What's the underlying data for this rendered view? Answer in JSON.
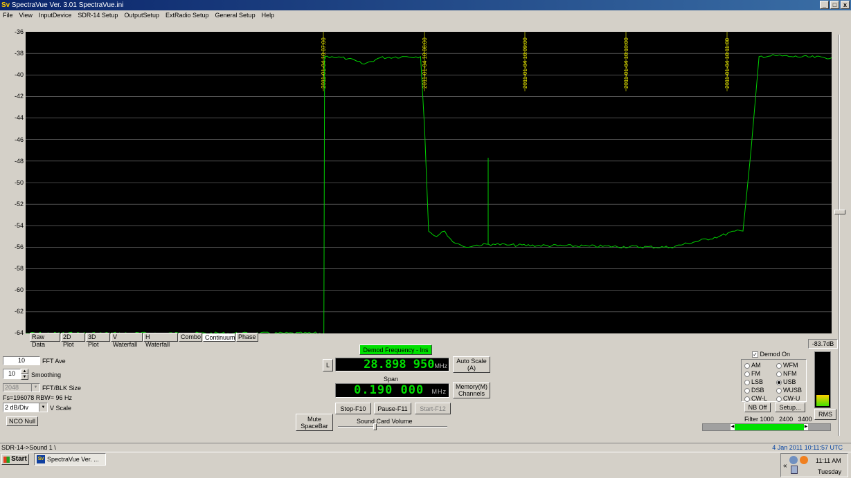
{
  "window": {
    "title": "SpectraVue Ver. 3.01 SpectraVue.ini",
    "logo": "Sv",
    "minimize": "_",
    "restore": "□",
    "close": "x"
  },
  "menu": [
    "File",
    "View",
    "InputDevice",
    "SDR-14 Setup",
    "OutputSetup",
    "ExtRadio Setup",
    "General Setup",
    "Help"
  ],
  "plot": {
    "y_ticks": [
      "-36",
      "-38",
      "-40",
      "-42",
      "-44",
      "-46",
      "-48",
      "-50",
      "-52",
      "-54",
      "-56",
      "-58",
      "-60",
      "-62",
      "-64"
    ],
    "time_marks": [
      "2011-01-04 10:07:00",
      "2011-01-04 10:08:00",
      "2011-01-04 10:09:00",
      "2011-01-04 10:10:00",
      "2011-01-04 10:11:00"
    ],
    "trace_color": "#00d000",
    "grid_color": "#808080"
  },
  "chart_data": {
    "type": "line",
    "ylim": [
      -64,
      -36
    ],
    "ylabel": "",
    "series": [
      {
        "x": [
          0,
          0.37,
          0.371,
          0.38,
          0.4,
          0.42,
          0.44,
          0.47,
          0.49,
          0.495,
          0.5,
          0.51,
          0.52,
          0.53,
          0.54,
          0.55,
          0.56,
          0.58,
          0.6,
          0.7,
          0.8,
          0.86,
          0.88,
          0.89,
          0.9,
          0.91,
          0.93,
          0.95,
          1.0
        ],
        "y": [
          -64,
          -64,
          -38.3,
          -38.3,
          -38.5,
          -39.0,
          -38.4,
          -38.3,
          -38.3,
          -45,
          -54.5,
          -55,
          -54.5,
          -55.5,
          -55.8,
          -56,
          -55.8,
          -55.7,
          -55.8,
          -55.9,
          -56,
          -55,
          -54.5,
          -54.5,
          -47,
          -38.3,
          -38.2,
          -38.3,
          -38.4
        ]
      }
    ]
  },
  "tabs": [
    "Raw Data",
    "2D Plot",
    "3D Plot",
    "V Waterfall",
    "H Waterfall",
    "Combo",
    "Continuum",
    "Phase"
  ],
  "active_tab": "Continuum",
  "left_controls": {
    "fft_ave_value": "10",
    "fft_ave_label": "FFT Ave",
    "smoothing_value": "10",
    "smoothing_label": "Smoothing",
    "fft_blk_value": "2048",
    "fft_blk_label": "FFT/BLK Size",
    "fs_info": "Fs=196078 RBW= 96 Hz",
    "vscale_value": "2 dB/Div",
    "vscale_label": "V Scale",
    "nco_null": "NCO Null"
  },
  "center_controls": {
    "demod_freq_button": "Demod Frequency - Ins",
    "l_button": "L",
    "freq_display": "28.898 950",
    "freq_unit": "MHz",
    "auto_scale": "Auto Scale (A)",
    "span_label": "Span",
    "span_display": "0.190 000",
    "span_unit": "MHz",
    "memory": "Memory(M) Channels",
    "stop": "Stop-F10",
    "pause": "Pause-F11",
    "start": "Start-F12",
    "mute": "Mute SpaceBar",
    "sound_card_volume": "Sound Card Volume"
  },
  "right_controls": {
    "level": "-83.7dB",
    "demod_on": "Demod On",
    "modes": [
      {
        "label": "AM",
        "on": false
      },
      {
        "label": "WFM",
        "on": false
      },
      {
        "label": "FM",
        "on": false
      },
      {
        "label": "NFM",
        "on": false
      },
      {
        "label": "LSB",
        "on": false
      },
      {
        "label": "USB",
        "on": true
      },
      {
        "label": "DSB",
        "on": false
      },
      {
        "label": "WUSB",
        "on": false
      },
      {
        "label": "CW-L",
        "on": false
      },
      {
        "label": "CW-U",
        "on": false
      }
    ],
    "nb_off": "NB Off",
    "setup": "Setup...",
    "rms": "RMS",
    "filter_label": "Filter",
    "filter_values": [
      "1000",
      "2400",
      "3400"
    ],
    "meter_fraction": 0.2
  },
  "status": {
    "left": "SDR-14->Sound 1  \\",
    "right": "4 Jan 2011  10:11:57 UTC"
  },
  "taskbar": {
    "start": "Start",
    "task": "SpectraVue Ver. ...",
    "chevron": "«",
    "time": "11:11 AM",
    "day": "Tuesday"
  }
}
